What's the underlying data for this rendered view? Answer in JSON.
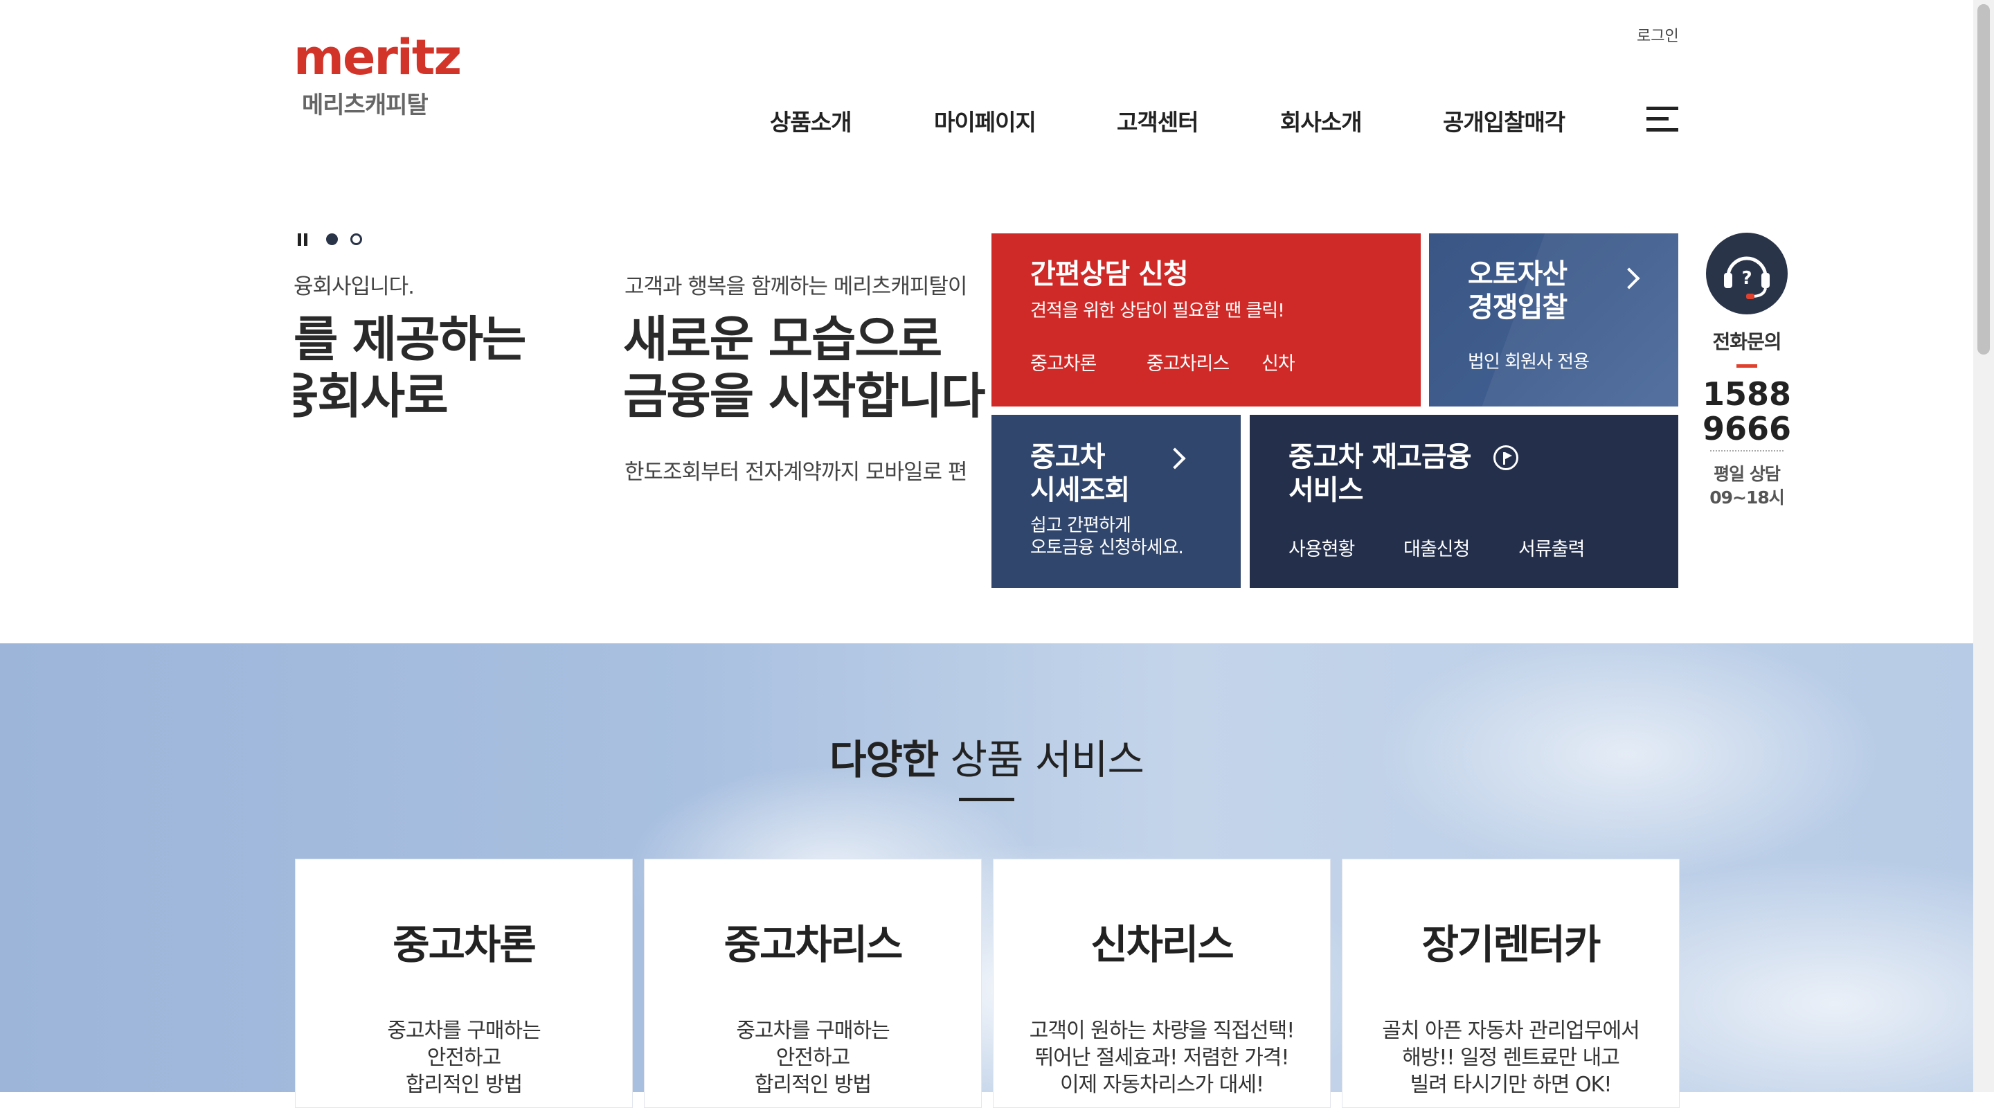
{
  "header": {
    "logo_en": "meritz",
    "logo_ko": "메리츠캐피탈",
    "login": "로그인",
    "nav": [
      "상품소개",
      "마이페이지",
      "고객센터",
      "회사소개",
      "공개입찰매각"
    ]
  },
  "slider": {
    "prev": {
      "small": "융회사입니다.",
      "big_line1": "를 제공하는",
      "big_line2": "융회사로"
    },
    "current": {
      "small": "고객과 행복을 함께하는 메리츠캐피탈이",
      "big_line1": "새로운 모습으로",
      "big_line2": "금융을 시작합니다",
      "desc": "한도조회부터 전자계약까지 모바일로 편"
    },
    "active_dot": 0,
    "dot_count": 2
  },
  "tiles": {
    "consult": {
      "title": "간편상담 신청",
      "sub": "견적을 위한 상담이 필요할 땐 클릭!",
      "links": [
        "중고차론",
        "중고차리스",
        "신차"
      ],
      "color": "#cf2a27"
    },
    "auction": {
      "title_line1": "오토자산",
      "title_line2": "경쟁입찰",
      "sub": "법인 회원사 전용",
      "color": "#3a5685"
    },
    "price": {
      "title_line1": "중고차",
      "title_line2": "시세조회",
      "sub_line1": "쉽고 간편하게",
      "sub_line2": "오토금융 신청하세요.",
      "color": "#31466c"
    },
    "inventory": {
      "title_line1": "중고차 재고금융",
      "title_line2": "서비스",
      "links": [
        "사용현황",
        "대출신청",
        "서류출력"
      ],
      "color": "#232f4b"
    }
  },
  "call": {
    "label": "전화문의",
    "number_line1": "1588",
    "number_line2": "9666",
    "hours_line1": "평일 상담",
    "hours_line2": "09~18시"
  },
  "services": {
    "title_bold": "다양한",
    "title_rest": " 상품 서비스",
    "cards": [
      {
        "title": "중고차론",
        "desc": "중고차를 구매하는\n안전하고\n합리적인 방법"
      },
      {
        "title": "중고차리스",
        "desc": "중고차를 구매하는\n안전하고\n합리적인 방법"
      },
      {
        "title": "신차리스",
        "desc": "고객이 원하는 차량을 직접선택!\n뛰어난 절세효과! 저렴한 가격!\n이제 자동차리스가 대세!"
      },
      {
        "title": "장기렌터카",
        "desc": "골치 아픈 자동차 관리업무에서\n해방!! 일정 렌트료만 내고\n빌려 타시기만 하면 OK!"
      }
    ]
  }
}
